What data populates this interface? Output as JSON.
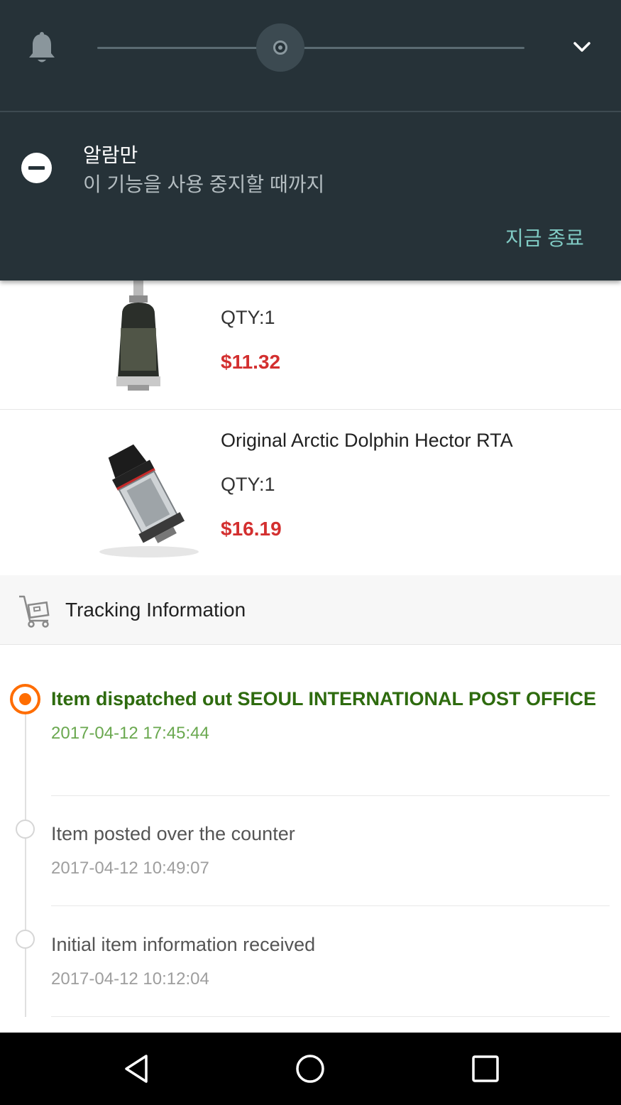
{
  "notification_shade": {
    "volume_slider": {
      "level_fraction": 0.43,
      "icon": "bell-icon",
      "expand_icon": "chevron-down-icon"
    },
    "dnd": {
      "icon": "dnd-minus-icon",
      "title": "알람만",
      "subtitle": "이 기능을 사용 중지할 때까지",
      "end_button_label": "지금 종료"
    }
  },
  "order": {
    "items": [
      {
        "name": "",
        "qty": "QTY:1",
        "price": "$11.32",
        "thumb": "rta-tank-black"
      },
      {
        "name": "Original Arctic Dolphin Hector RTA",
        "qty": "QTY:1",
        "price": "$16.19",
        "thumb": "rta-tank-silver"
      }
    ]
  },
  "tracking": {
    "header_icon": "cart-icon",
    "title": "Tracking Information",
    "events": [
      {
        "description": "Item dispatched out SEOUL INTERNATIONAL POST OFFICE",
        "timestamp": "2017-04-12 17:45:44",
        "active": true
      },
      {
        "description": "Item posted over the counter",
        "timestamp": "2017-04-12 10:49:07",
        "active": false
      },
      {
        "description": "Initial item information received",
        "timestamp": "2017-04-12 10:12:04",
        "active": false
      }
    ]
  },
  "navbar": {
    "back": "back-icon",
    "home": "home-icon",
    "recents": "recents-icon"
  },
  "colors": {
    "shade_bg": "#263238",
    "accent_teal": "#80cbc4",
    "price_red": "#d32f2f",
    "active_green": "#2e6b0e",
    "timeline_orange": "#ff6d00"
  }
}
